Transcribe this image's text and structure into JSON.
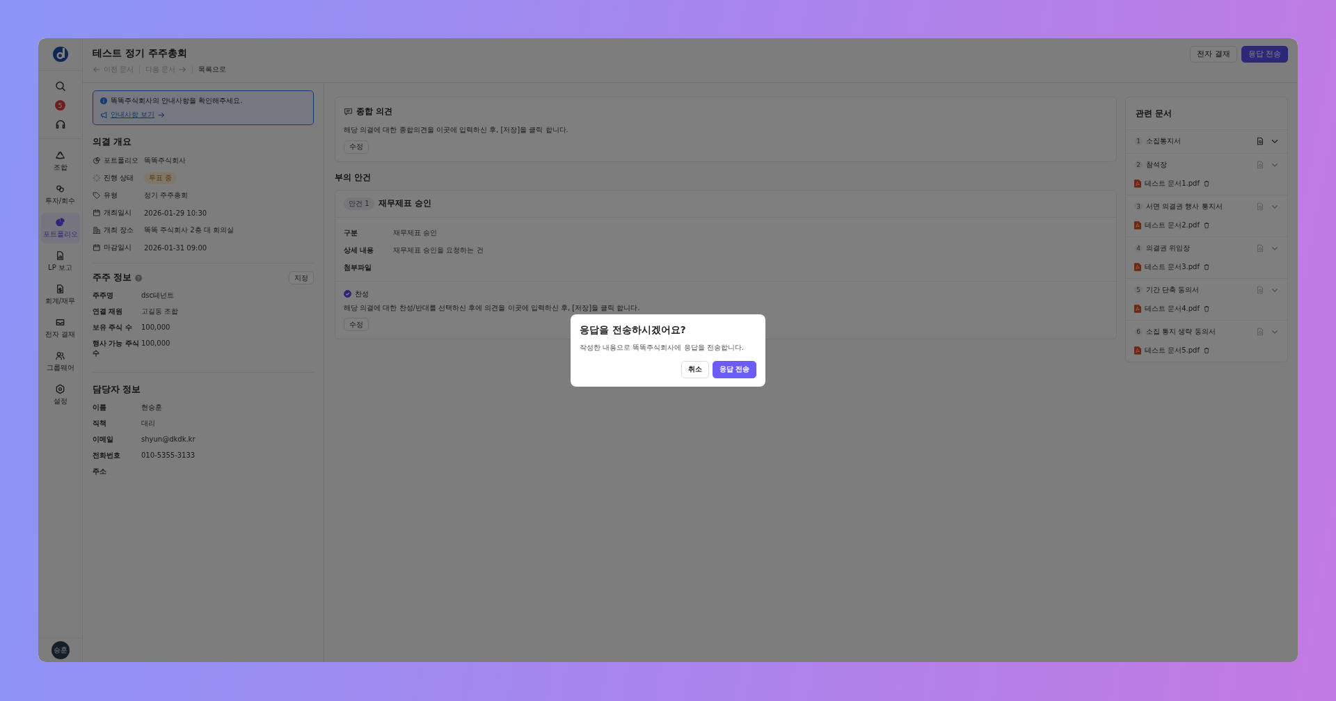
{
  "sidebar": {
    "notification_count": "5",
    "items": [
      {
        "label": "조합",
        "selected": false
      },
      {
        "label": "투자/회수",
        "selected": false
      },
      {
        "label": "포트폴리오",
        "selected": true
      },
      {
        "label": "LP 보고",
        "selected": false
      },
      {
        "label": "회계/재무",
        "selected": false
      },
      {
        "label": "전자 결재",
        "selected": false
      },
      {
        "label": "그룹웨어",
        "selected": false
      },
      {
        "label": "설정",
        "selected": false
      }
    ],
    "avatar": "승훈"
  },
  "header": {
    "title": "테스트 정기 주주총회",
    "nav": [
      {
        "label": "이전 문서",
        "kind": "prev",
        "disabled": true
      },
      {
        "label": "다음 문서",
        "kind": "next",
        "disabled": true
      },
      {
        "label": "목록으로",
        "kind": "list",
        "disabled": false
      }
    ],
    "buttons": [
      {
        "label": "전자 결재",
        "kind": "secondary"
      },
      {
        "label": "응답 전송",
        "kind": "primary"
      }
    ]
  },
  "notice": {
    "text": "똑똑주식회사의 안내사항을 확인해주세요.",
    "link": "안내사항 보기"
  },
  "overview": {
    "title": "의결 개요",
    "rows": [
      {
        "label": "포트폴리오",
        "value": "똑똑주식회사",
        "kind": "text"
      },
      {
        "label": "진행 상태",
        "value": "투표 중",
        "kind": "badge"
      },
      {
        "label": "유형",
        "value": "정기 주주총회",
        "kind": "text"
      },
      {
        "label": "개최일시",
        "value": "2026-01-29 10:30",
        "kind": "text"
      },
      {
        "label": "개최 장소",
        "value": "똑똑 주식회사 2층 대 회의실",
        "kind": "text"
      },
      {
        "label": "마감일시",
        "value": "2026-01-31 09:00",
        "kind": "text"
      }
    ]
  },
  "shareholder": {
    "title": "주주 정보",
    "button": "지정",
    "rows": [
      {
        "label": "주주명",
        "value": "dsc테넌트"
      },
      {
        "label": "연결 재원",
        "value": "고길동 조합"
      },
      {
        "label": "보유 주식 수",
        "value": "100,000"
      },
      {
        "label": "행사 가능 주식 수",
        "value": "100,000"
      }
    ]
  },
  "contact": {
    "title": "담당자 정보",
    "rows": [
      {
        "label": "이름",
        "value": "현승훈"
      },
      {
        "label": "직책",
        "value": "대리"
      },
      {
        "label": "이메일",
        "value": "shyun@dkdk.kr"
      },
      {
        "label": "전화번호",
        "value": "010-5355-3133"
      },
      {
        "label": "주소"
      }
    ]
  },
  "opinion": {
    "title": "종합 의견",
    "text": "해당 의결에 대한 종합의견을 이곳에 입력하신 후, [저장]을 클릭 합니다.",
    "button": "수정"
  },
  "agenda_heading": "부의 안건",
  "agendas": [
    {
      "tag": "안건 1",
      "title": "재무제표 승인",
      "rows": [
        {
          "label": "구분",
          "value": "재무제표 승인"
        },
        {
          "label": "상세 내용",
          "value": "재무제표 승인을 요청하는 건"
        },
        {
          "label": "첨부파일"
        }
      ],
      "vote": {
        "label": "찬성",
        "checked": true
      },
      "text": "해당 의결에 대한 찬성/반대를 선택하신 후에 의견을 이곳에 입력하신 후, [저장]을 클릭 합니다.",
      "button": "수정"
    }
  ],
  "related": {
    "title": "관련 문서",
    "items": [
      {
        "number": "1",
        "name": "소집통지서",
        "active": true
      },
      {
        "number": "2",
        "name": "참석장",
        "active": false,
        "files": [
          "테스트 문서1.pdf"
        ]
      },
      {
        "number": "3",
        "name": "서면 의결권 행사 통지서",
        "active": false,
        "files": [
          "테스트 문서2.pdf"
        ]
      },
      {
        "number": "4",
        "name": "의결권 위임장",
        "active": false,
        "files": [
          "테스트 문서3.pdf"
        ]
      },
      {
        "number": "5",
        "name": "기간 단축 동의서",
        "active": false,
        "files": [
          "테스트 문서4.pdf"
        ]
      },
      {
        "number": "6",
        "name": "소집 통지 생략 동의서",
        "active": false,
        "files": [
          "테스트 문서5.pdf"
        ]
      }
    ]
  },
  "dialog": {
    "title": "응답을 전송하시겠어요?",
    "message": "작성한 내용으로 똑똑주식회사에 응답을 전송합니다.",
    "buttons": [
      {
        "label": "취소",
        "kind": "secondary"
      },
      {
        "label": "응답 전송",
        "kind": "primary"
      }
    ]
  }
}
